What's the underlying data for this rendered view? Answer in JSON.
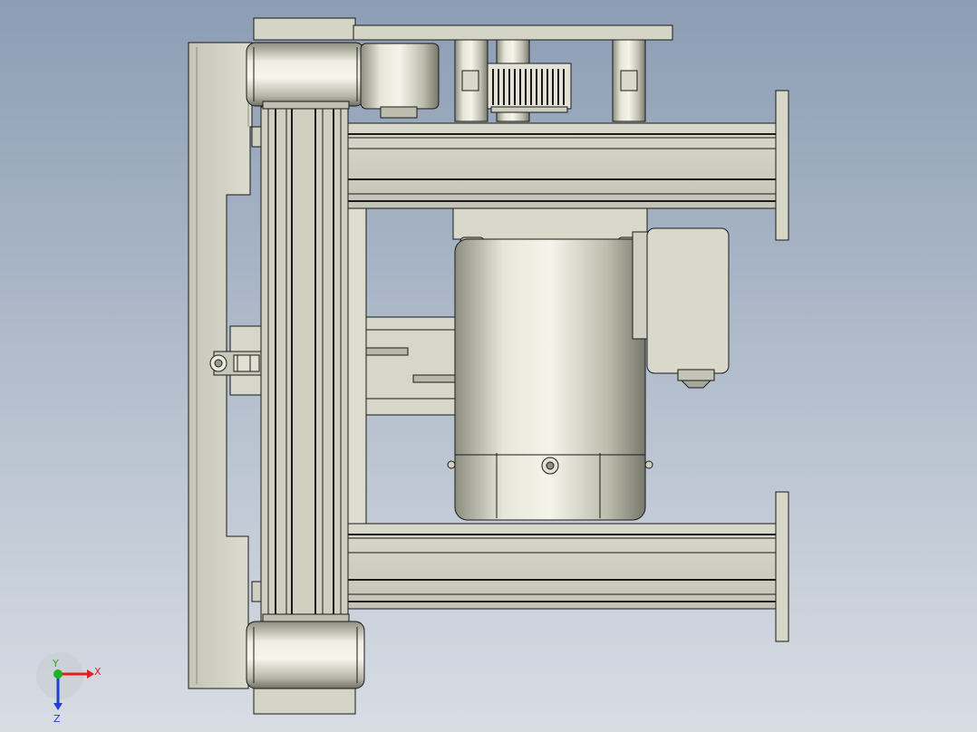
{
  "viewport": {
    "background_top": "#8c9db4",
    "background_bottom": "#d8dde4",
    "metal_light": "#ececdf",
    "metal_mid": "#c9c9bb",
    "metal_dark": "#9a9a8c",
    "outline": "#1a1a1a"
  },
  "triad": {
    "x_label": "X",
    "y_label": "Y",
    "z_label": "Z",
    "x_color": "#e02020",
    "y_color": "#20b020",
    "z_color": "#2040d0"
  }
}
